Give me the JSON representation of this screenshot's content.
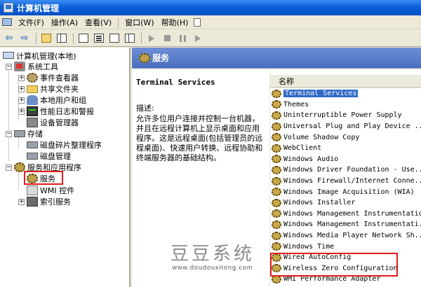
{
  "window": {
    "title": "计算机管理"
  },
  "menu": {
    "items": [
      "文件(F)",
      "操作(A)",
      "查看(V)",
      "窗口(W)",
      "帮助(H)"
    ]
  },
  "tree": {
    "root": "计算机管理(本地)",
    "system_tools": "系统工具",
    "event_viewer": "事件查看器",
    "shared_folders": "共享文件夹",
    "local_users": "本地用户和组",
    "perf_logs": "性能日志和警报",
    "device_manager": "设备管理器",
    "storage": "存储",
    "defrag": "磁盘碎片整理程序",
    "disk_mgmt": "磁盘管理",
    "services_apps": "服务和应用程序",
    "services": "服务",
    "wmi": "WMI 控件",
    "indexing": "索引服务"
  },
  "header": {
    "title": "服务"
  },
  "detail": {
    "service_name": "Terminal Services",
    "desc_label": "描述:",
    "desc_text": "允许多位用户连接并控制一台机器，并且在远程计算机上显示桌面和应用程序。这是远程桌面(包括管理员的远程桌面)、快速用户转换、远程协助和终端服务器的基础结构。"
  },
  "list": {
    "column_name": "名称",
    "rows": [
      "Terminal Services",
      "Themes",
      "Uninterruptible Power Supply",
      "Universal Plug and Play Device ...",
      "Volume Shadow Copy",
      "WebClient",
      "Windows Audio",
      "Windows Driver Foundation - Use...",
      "Windows Firewall/Internet Conne...",
      "Windows Image Acquisition (WIA)",
      "Windows Installer",
      "Windows Management Instrumentation",
      "Windows Management Instrumentati...",
      "Windows Media Player Network Sh...",
      "Windows Time",
      "Wired AutoConfig",
      "Wireless Zero Configuration",
      "WMI Performance Adapter"
    ],
    "selected_index": 0
  },
  "watermark": {
    "title": "豆豆系统",
    "url": "www.doudouxitong.com"
  },
  "colors": {
    "highlight": "#e41b1b",
    "selection": "#316ac5",
    "titlebar": "#0a5fd6"
  }
}
